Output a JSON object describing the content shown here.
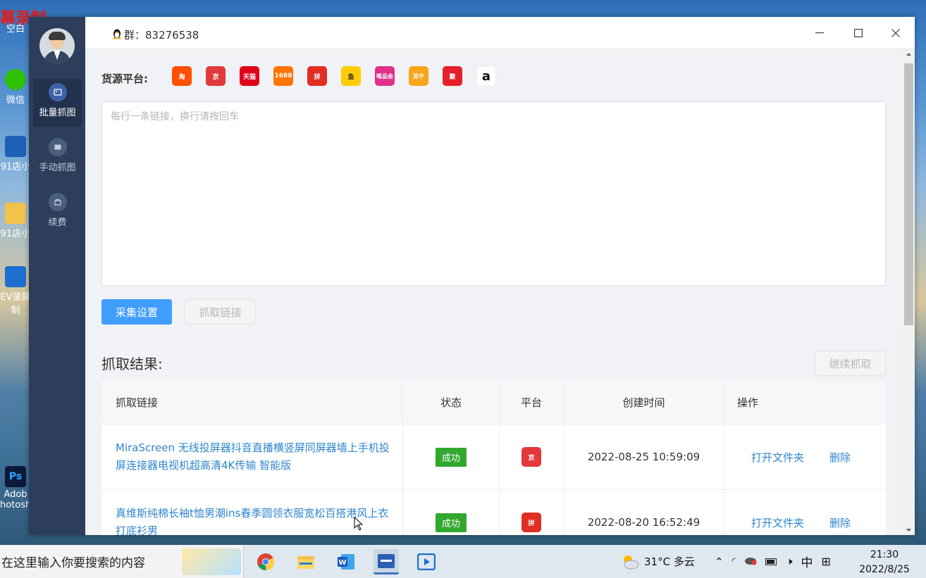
{
  "desktop": {
    "recording_label": "幕录制",
    "icons": [
      {
        "label": "空白",
        "icon": "blank-icon"
      },
      {
        "label": "微信",
        "icon": "wechat-icon"
      },
      {
        "label": "91店小",
        "icon": "app-icon"
      },
      {
        "label": "91店小",
        "icon": "folder-icon"
      },
      {
        "label": "EV录屏",
        "sub": "制",
        "icon": "recorder-icon"
      },
      {
        "label": "Adob",
        "sub": "hotosh",
        "icon": "photoshop-icon"
      }
    ]
  },
  "sidebar": {
    "items": [
      {
        "label": "批量抓图",
        "icon": "image-batch-icon",
        "active": true
      },
      {
        "label": "手动抓图",
        "icon": "image-manual-icon",
        "active": false
      },
      {
        "label": "续费",
        "icon": "renew-icon",
        "active": false
      }
    ]
  },
  "titlebar": {
    "group_label": "群：83276538",
    "controls": [
      "minimize",
      "maximize",
      "close"
    ]
  },
  "source": {
    "label": "货源平台:",
    "platforms": [
      {
        "name": "淘宝",
        "short": "淘",
        "color": "#ff5000"
      },
      {
        "name": "京东",
        "short": "京",
        "color": "#e4393c"
      },
      {
        "name": "天猫",
        "short": "天猫",
        "color": "#e0001a"
      },
      {
        "name": "1688",
        "short": "1688",
        "color": "#ff7300"
      },
      {
        "name": "拼多多",
        "short": "拼",
        "color": "#e02e24"
      },
      {
        "name": "闲鱼",
        "short": "鱼",
        "color": "#ffcd00"
      },
      {
        "name": "唯品会",
        "short": "唯品会",
        "color": "#e0308c"
      },
      {
        "name": "苏宁",
        "short": "苏宁",
        "color": "#f7a51c"
      },
      {
        "name": "聚美",
        "short": "聚",
        "color": "#e5202a"
      },
      {
        "name": "亚马逊",
        "short": "a",
        "color": "#ffffff"
      }
    ]
  },
  "link_input": {
    "placeholder": "每行一条链接，换行请按回车",
    "value": ""
  },
  "buttons": {
    "settings": "采集设置",
    "fetch": "抓取链接",
    "continue": "继续抓取"
  },
  "results": {
    "title": "抓取结果:",
    "columns": [
      "抓取链接",
      "状态",
      "平台",
      "创建时间",
      "操作"
    ],
    "rows": [
      {
        "link": "MiraScreen 无线投屏器抖音直播横竖屏同屏器墙上手机投屏连接器电视机超高清4K传输 智能版",
        "status": "成功",
        "platform": "京东",
        "platform_short": "京",
        "platform_color": "#e4393c",
        "created": "2022-08-25 10:59:09",
        "op_open": "打开文件夹",
        "op_delete": "删除"
      },
      {
        "link": "真维斯纯棉长袖t恤男潮ins春季圆领衣服宽松百搭港风上衣打底衫男",
        "status": "成功",
        "platform": "拼多多",
        "platform_short": "拼",
        "platform_color": "#e02e24",
        "created": "2022-08-20 16:52:49",
        "op_open": "打开文件夹",
        "op_delete": "删除"
      }
    ]
  },
  "taskbar": {
    "search_placeholder": "在这里输入你要搜索的内容",
    "weather": "31°C 多云",
    "ime": "中",
    "time": "21:30",
    "date": "2022/8/25"
  }
}
